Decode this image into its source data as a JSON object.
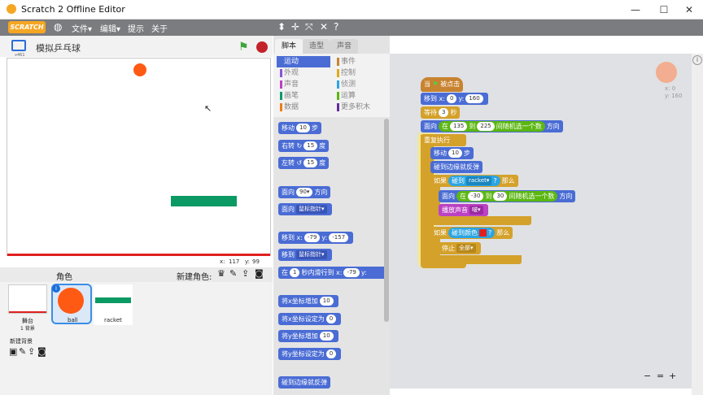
{
  "window": {
    "title": "Scratch 2 Offline Editor",
    "min": "—",
    "max": "☐",
    "close": "✕"
  },
  "menu": {
    "logo": "SCRATCH",
    "file": "文件▾",
    "edit": "编辑▾",
    "tips": "提示",
    "about": "关于"
  },
  "stage": {
    "project_name": "模拟乒乓球",
    "version": "v461",
    "x_label": "x:",
    "x_val": "117",
    "y_label": "y:",
    "y_val": "99"
  },
  "sprites": {
    "header": "角色",
    "new_sprite": "新建角色:",
    "stage_label": "舞台",
    "stage_bg": "1 背景",
    "new_backdrop": "新建背景",
    "items": [
      {
        "name": "ball"
      },
      {
        "name": "racket"
      }
    ]
  },
  "tabs": [
    "脚本",
    "造型",
    "声音"
  ],
  "categories": {
    "left": [
      {
        "label": "运动",
        "color": "#4a6cd4"
      },
      {
        "label": "外观",
        "color": "#8a55d7"
      },
      {
        "label": "声音",
        "color": "#bb42c3"
      },
      {
        "label": "画笔",
        "color": "#0e9a6c"
      },
      {
        "label": "数据",
        "color": "#ee7d16"
      }
    ],
    "right": [
      {
        "label": "事件",
        "color": "#c88330"
      },
      {
        "label": "控制",
        "color": "#e1a91a"
      },
      {
        "label": "侦测",
        "color": "#2ca5e2"
      },
      {
        "label": "运算",
        "color": "#5cb712"
      },
      {
        "label": "更多积木",
        "color": "#632d99"
      }
    ]
  },
  "palette": {
    "move": "移动",
    "move_n": "10",
    "steps": "步",
    "turn_r": "右转",
    "turn_r_n": "15",
    "deg": "度",
    "turn_l": "左转",
    "turn_l_n": "15",
    "point_dir": "面向",
    "point_dir_n": "90▾",
    "dir": "方向",
    "point_to": "面向",
    "point_to_d": "鼠标指针▾",
    "goto_xy": "移到 x:",
    "goto_x": "-79",
    "goto_y_label": "y:",
    "goto_y": "-157",
    "goto": "移到",
    "goto_d": "鼠标指针▾",
    "glide": "在",
    "glide_n": "1",
    "glide_t": "秒内滑行到 x:",
    "glide_x": "-79",
    "glide_y": "y:",
    "chx": "将x坐标增加",
    "chx_n": "10",
    "setx": "将x坐标设定为",
    "setx_n": "0",
    "chy": "将y坐标增加",
    "chy_n": "10",
    "sety": "将y坐标设定为",
    "sety_n": "0",
    "bounce": "碰到边缘就反弹"
  },
  "script": {
    "when": "当",
    "clicked": "被点击",
    "goto": "移到 x:",
    "gx": "0",
    "gy_label": "y:",
    "gy": "160",
    "wait": "等待",
    "wait_n": "3",
    "secs": "秒",
    "point": "面向",
    "point_in": "在",
    "r1": "135",
    "to": "到",
    "r2": "225",
    "rand": "间随机选一个数",
    "dir": "方向",
    "forever": "重复执行",
    "move": "移动",
    "move_n": "10",
    "steps": "步",
    "bounce": "碰到边缘就反弹",
    "if": "如果",
    "touching": "碰到",
    "racket": "racket▾",
    "q": "?",
    "then": "那么",
    "point2": "面向",
    "in2": "在",
    "r3": "-30",
    "to2": "到",
    "r4": "30",
    "rand2": "间随机选一个数",
    "dir2": "方向",
    "play": "播放声音",
    "sound": "啵▾",
    "if2": "如果",
    "touch_color": "碰到颜色",
    "q2": "?",
    "then2": "那么",
    "stop": "停止",
    "stop_d": "全部▾"
  },
  "sprite_info": {
    "x": "x: 0",
    "y": "y: 160"
  },
  "zoom": {
    "out": "−",
    "reset": "=",
    "in": "+"
  }
}
